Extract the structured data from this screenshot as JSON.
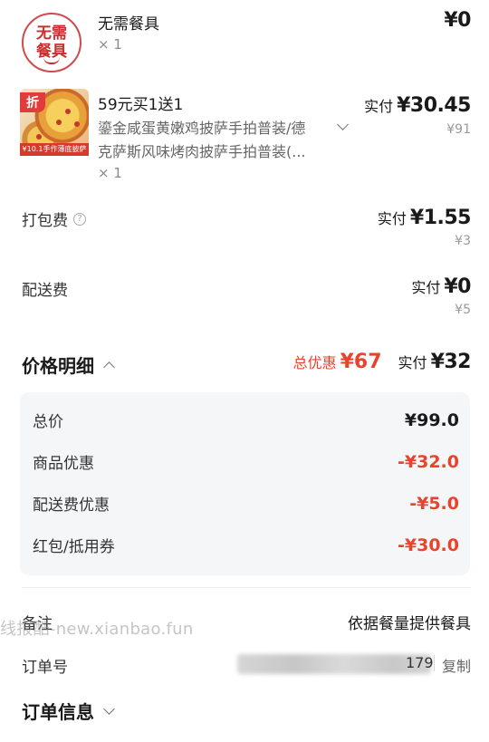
{
  "items": [
    {
      "badge_line1": "无需",
      "badge_line2": "餐具",
      "name": "无需餐具",
      "qty": "× 1",
      "price": "¥0"
    },
    {
      "discount_tag": "折",
      "thumb_strip": "¥10.1手作薄底披萨",
      "promo": "59元买1送1",
      "name_line1": "鎏金咸蛋黄嫩鸡披萨手拍普装/德",
      "name_line2": "克萨斯风味烤肉披萨手拍普装(...",
      "qty": "× 1",
      "paid_label": "实付",
      "paid_price": "¥30.45",
      "orig_price": "¥91"
    }
  ],
  "fees": [
    {
      "label": "打包费",
      "info_icon": "?",
      "paid_label": "实付",
      "paid_price": "¥1.55",
      "orig_price": "¥3"
    },
    {
      "label": "配送费",
      "paid_label": "实付",
      "paid_price": "¥0",
      "orig_price": "¥5"
    }
  ],
  "price_detail": {
    "title": "价格明细",
    "discount_label": "总优惠",
    "discount_value": "¥67",
    "paid_label": "实付",
    "paid_value": "¥32",
    "rows": [
      {
        "label": "总价",
        "value": "¥99.0"
      },
      {
        "label": "商品优惠",
        "value": "-¥32.0"
      },
      {
        "label": "配送费优惠",
        "value": "-¥5.0"
      },
      {
        "label": "红包/抵用券",
        "value": "-¥30.0"
      }
    ]
  },
  "remarks": {
    "label": "备注",
    "value": "依据餐量提供餐具"
  },
  "order_no": {
    "label": "订单号",
    "tail": "179",
    "copy_label": "复制"
  },
  "order_info": {
    "title": "订单信息"
  },
  "watermark": "线报酷-new.xianbao.fun",
  "colors": {
    "accent_red": "#e8432d",
    "badge_red": "#c8302f",
    "panel_bg": "#f5f6f8"
  }
}
